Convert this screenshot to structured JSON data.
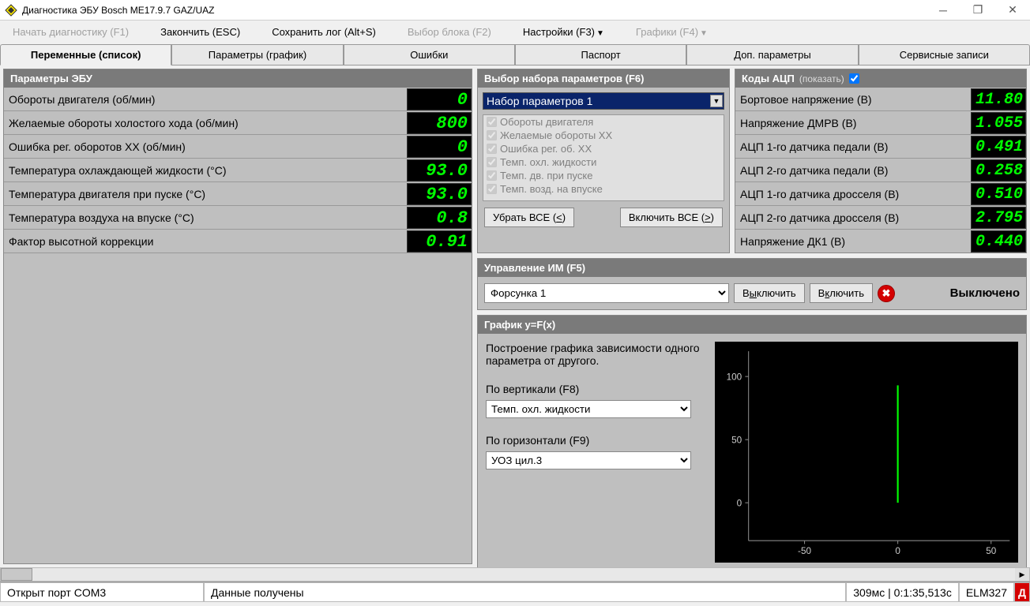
{
  "window": {
    "title": "Диагностика ЭБУ Bosch ME17.9.7 GAZ/UAZ"
  },
  "menu": {
    "start": "Начать диагностику (F1)",
    "finish": "Закончить (ESC)",
    "savelog": "Сохранить лог (Alt+S)",
    "selectblock": "Выбор блока (F2)",
    "settings": "Настройки (F3)",
    "charts": "Графики (F4)"
  },
  "tabs": [
    "Переменные (список)",
    "Параметры (график)",
    "Ошибки",
    "Паспорт",
    "Доп. параметры",
    "Сервисные записи"
  ],
  "ecu": {
    "title": "Параметры ЭБУ",
    "rows": [
      {
        "label": "Обороты двигателя (об/мин)",
        "value": "0"
      },
      {
        "label": "Желаемые обороты холостого хода (об/мин)",
        "value": "800"
      },
      {
        "label": "Ошибка рег. оборотов ХХ (об/мин)",
        "value": "0"
      },
      {
        "label": "Температура охлаждающей жидкости (°C)",
        "value": "93.0"
      },
      {
        "label": "Температура двигателя при пуске (°C)",
        "value": "93.0"
      },
      {
        "label": "Температура воздуха на впуске (°C)",
        "value": "0.8"
      },
      {
        "label": "Фактор высотной коррекции",
        "value": "0.91"
      }
    ]
  },
  "paramset": {
    "title": "Выбор набора параметров (F6)",
    "selected": "Набор параметров 1",
    "items": [
      "Обороты двигателя",
      "Желаемые обороты ХХ",
      "Ошибка рег. об. ХХ",
      "Темп. охл. жидкости",
      "Темп. дв. при пуске",
      "Темп. возд. на впуске"
    ],
    "remove": "Убрать ВСЕ (<)",
    "add": "Включить ВСЕ (>)"
  },
  "adc": {
    "title": "Коды АЦП",
    "showtxt": "(показать)",
    "rows": [
      {
        "label": "Бортовое напряжение (В)",
        "value": "11.80"
      },
      {
        "label": "Напряжение ДМРВ (В)",
        "value": "1.055"
      },
      {
        "label": "АЦП 1-го датчика педали (В)",
        "value": "0.491"
      },
      {
        "label": "АЦП 2-го датчика педали (В)",
        "value": "0.258"
      },
      {
        "label": "АЦП 1-го датчика дросселя (В)",
        "value": "0.510"
      },
      {
        "label": "АЦП 2-го датчика дросселя (В)",
        "value": "2.795"
      },
      {
        "label": "Напряжение ДК1 (В)",
        "value": "0.440"
      }
    ]
  },
  "im": {
    "title": "Управление ИМ (F5)",
    "selected": "Форсунка 1",
    "off": "Выключить",
    "on": "Включить",
    "status": "Выключено"
  },
  "graph": {
    "title": "График y=F(x)",
    "desc": "Построение графика зависимости одного параметра от другого.",
    "ylabel": "По вертикали (F8)",
    "ysel": "Темп. охл. жидкости",
    "xlabel": "По горизонтали (F9)",
    "xsel": "УОЗ цил.3"
  },
  "chart_data": {
    "type": "scatter",
    "title": "",
    "xlabel": "",
    "ylabel": "",
    "xlim": [
      -80,
      60
    ],
    "ylim": [
      -30,
      120
    ],
    "xticks": [
      -50,
      0,
      50
    ],
    "yticks": [
      0,
      50,
      100
    ],
    "series": [
      {
        "name": "point",
        "x": [
          0
        ],
        "y": [
          93
        ]
      }
    ]
  },
  "status": {
    "port": "Открыт порт COM3",
    "data": "Данные получены",
    "latency": "309мс",
    "time": "0:1:35,513с",
    "adapter": "ELM327",
    "flag": "Д"
  }
}
